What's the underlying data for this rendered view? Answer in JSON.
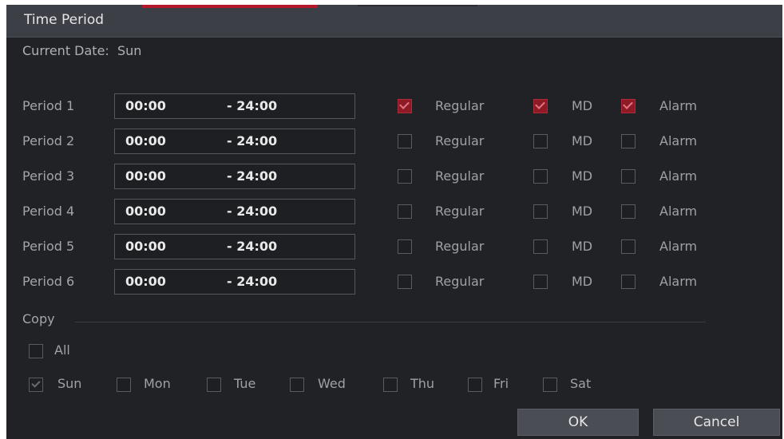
{
  "dialog": {
    "title": "Time Period",
    "current_date_label": "Current Date:",
    "current_date_value": "Sun"
  },
  "periods": [
    {
      "label": "Period 1",
      "start": "00:00",
      "end": "- 24:00",
      "regular": true,
      "md": true,
      "alarm": true
    },
    {
      "label": "Period 2",
      "start": "00:00",
      "end": "- 24:00",
      "regular": false,
      "md": false,
      "alarm": false
    },
    {
      "label": "Period 3",
      "start": "00:00",
      "end": "- 24:00",
      "regular": false,
      "md": false,
      "alarm": false
    },
    {
      "label": "Period 4",
      "start": "00:00",
      "end": "- 24:00",
      "regular": false,
      "md": false,
      "alarm": false
    },
    {
      "label": "Period 5",
      "start": "00:00",
      "end": "- 24:00",
      "regular": false,
      "md": false,
      "alarm": false
    },
    {
      "label": "Period 6",
      "start": "00:00",
      "end": "- 24:00",
      "regular": false,
      "md": false,
      "alarm": false
    }
  ],
  "options": {
    "regular": "Regular",
    "md": "MD",
    "alarm": "Alarm"
  },
  "copy": {
    "label": "Copy",
    "all_label": "All",
    "all_checked": false,
    "days": [
      {
        "label": "Sun",
        "checked": true,
        "disabled": true
      },
      {
        "label": "Mon",
        "checked": false
      },
      {
        "label": "Tue",
        "checked": false
      },
      {
        "label": "Wed",
        "checked": false
      },
      {
        "label": "Thu",
        "checked": false
      },
      {
        "label": "Fri",
        "checked": false
      },
      {
        "label": "Sat",
        "checked": false
      }
    ]
  },
  "buttons": {
    "ok": "OK",
    "cancel": "Cancel"
  },
  "colors": {
    "background": "#212226",
    "titlebar": "#3c3f46",
    "accent_red": "#b5283a"
  }
}
